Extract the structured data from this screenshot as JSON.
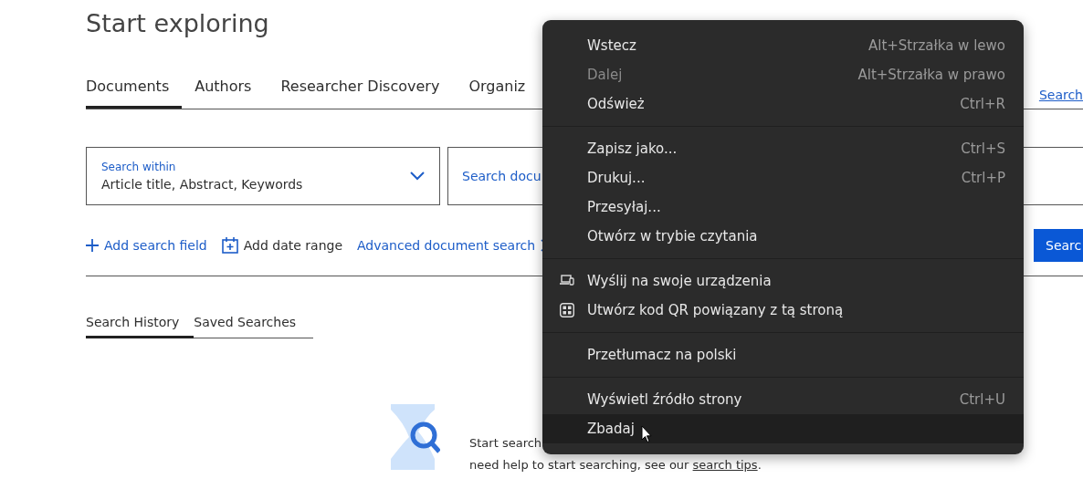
{
  "page": {
    "title": "Start exploring",
    "tabs": [
      {
        "label": "Documents",
        "selected": true
      },
      {
        "label": "Authors",
        "selected": false
      },
      {
        "label": "Researcher Discovery",
        "selected": false
      },
      {
        "label": "Organiz",
        "selected": false
      }
    ],
    "search_tips_link": "Search",
    "search_within": {
      "label": "Search within",
      "value": "Article title, Abstract, Keywords"
    },
    "search_field": {
      "placeholder": "Search docu"
    },
    "actions": [
      {
        "kind": "plus",
        "label": "Add search field"
      },
      {
        "kind": "calendar",
        "label": "Add date range"
      },
      {
        "kind": "chevron",
        "label": "Advanced document search"
      }
    ],
    "search_button": "Searc",
    "history_tabs": [
      {
        "label": "Search History",
        "selected": true
      },
      {
        "label": "Saved Searches",
        "selected": false
      }
    ],
    "empty_state": {
      "line_1": "Start search",
      "line_2": "need help to start searching, see our ",
      "link": "search tips",
      "end": "."
    }
  },
  "context_menu": {
    "groups": [
      [
        {
          "label": "Wstecz",
          "shortcut": "Alt+Strzałka w lewo",
          "disabled": false,
          "highlighted": false
        },
        {
          "label": "Dalej",
          "shortcut": "Alt+Strzałka w prawo",
          "disabled": true,
          "highlighted": false
        },
        {
          "label": "Odśwież",
          "shortcut": "Ctrl+R",
          "disabled": false,
          "highlighted": false
        }
      ],
      [
        {
          "label": "Zapisz jako...",
          "shortcut": "Ctrl+S",
          "disabled": false,
          "highlighted": false
        },
        {
          "label": "Drukuj...",
          "shortcut": "Ctrl+P",
          "disabled": false,
          "highlighted": false
        },
        {
          "label": "Przesyłaj...",
          "disabled": false,
          "highlighted": false
        },
        {
          "label": "Otwórz w trybie czytania",
          "disabled": false,
          "highlighted": false
        }
      ],
      [
        {
          "label": "Wyślij na swoje urządzenia",
          "kind": "devices",
          "disabled": false,
          "highlighted": false
        },
        {
          "label": "Utwórz kod QR powiązany z tą stroną",
          "kind": "qr",
          "disabled": false,
          "highlighted": false
        }
      ],
      [
        {
          "label": "Przetłumacz na polski",
          "disabled": false,
          "highlighted": false
        }
      ],
      [
        {
          "label": "Wyświetl źródło strony",
          "shortcut": "Ctrl+U",
          "disabled": false,
          "highlighted": false
        },
        {
          "label": "Zbadaj",
          "disabled": false,
          "highlighted": true
        }
      ]
    ]
  }
}
